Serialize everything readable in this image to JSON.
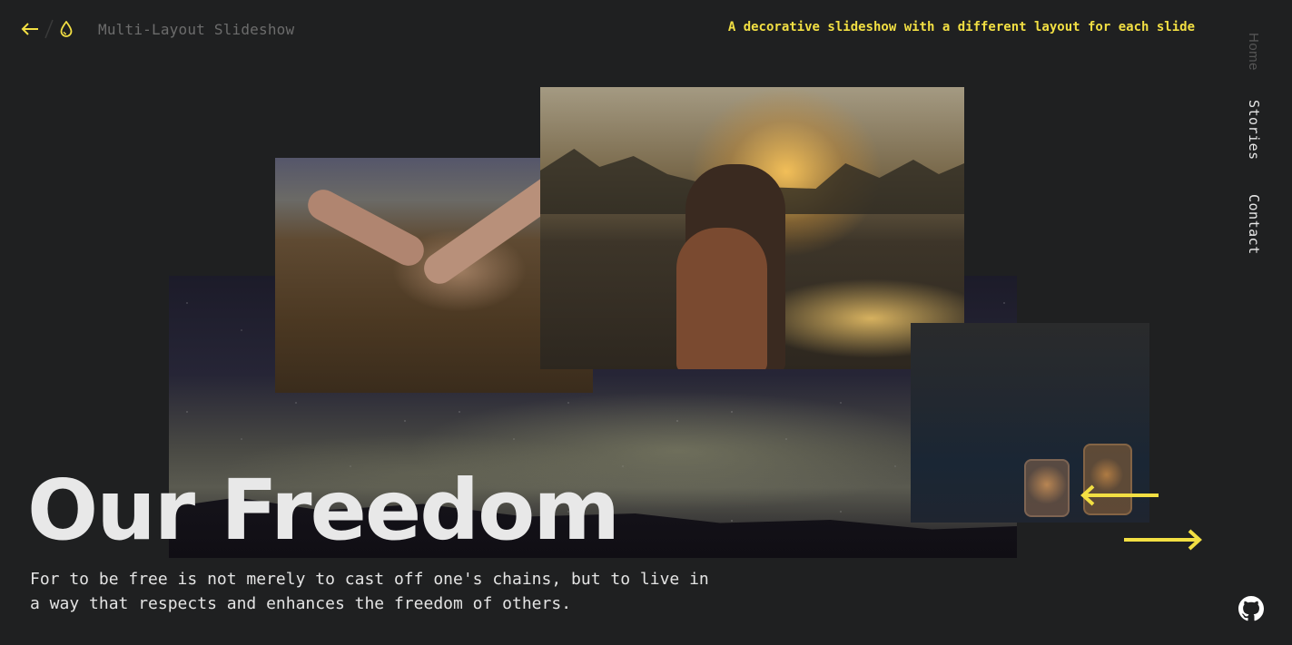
{
  "header": {
    "title": "Multi-Layout Slideshow",
    "tagline": "A decorative slideshow with a different layout for each slide"
  },
  "nav": {
    "items": [
      "Home",
      "Stories",
      "Contact"
    ]
  },
  "slide": {
    "title": "Our Freedom",
    "quote": "For to be free is not merely to cast off one's chains, but to live in a way that respects and enhances the freedom of others."
  },
  "colors": {
    "accent": "#f2df43",
    "background": "#1f2021",
    "text": "#e8e8e8"
  },
  "icons": [
    "back-arrow-icon",
    "drop-icon",
    "prev-arrow-icon",
    "next-arrow-icon",
    "github-icon"
  ]
}
